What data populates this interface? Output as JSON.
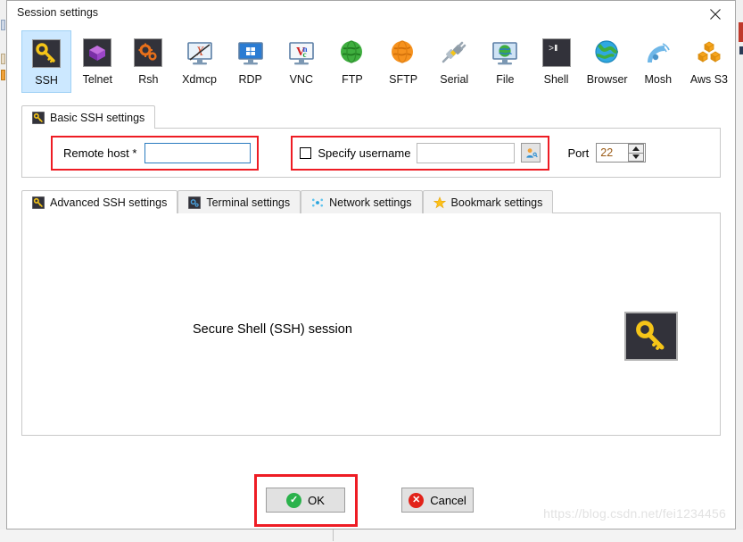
{
  "window": {
    "title": "Session settings",
    "close_icon": "close-icon"
  },
  "session_types": {
    "selected": "SSH",
    "items": [
      {
        "label": "SSH",
        "icon": "key-icon"
      },
      {
        "label": "Telnet",
        "icon": "cube-icon"
      },
      {
        "label": "Rsh",
        "icon": "gears-icon"
      },
      {
        "label": "Xdmcp",
        "icon": "x-monitor-icon"
      },
      {
        "label": "RDP",
        "icon": "windows-monitor-icon"
      },
      {
        "label": "VNC",
        "icon": "vnc-monitor-icon"
      },
      {
        "label": "FTP",
        "icon": "green-globe-icon"
      },
      {
        "label": "SFTP",
        "icon": "orange-globe-icon"
      },
      {
        "label": "Serial",
        "icon": "plug-icon"
      },
      {
        "label": "File",
        "icon": "file-monitor-icon"
      },
      {
        "label": "Shell",
        "icon": "terminal-icon"
      },
      {
        "label": "Browser",
        "icon": "browser-globe-icon"
      },
      {
        "label": "Mosh",
        "icon": "satellite-dish-icon"
      },
      {
        "label": "Aws S3",
        "icon": "aws-boxes-icon"
      }
    ]
  },
  "basic_tab": {
    "label": "Basic SSH settings",
    "icon": "key-icon",
    "remote_host": {
      "label": "Remote host *",
      "value": "",
      "placeholder": ""
    },
    "specify_username": {
      "label": "Specify username",
      "checked": false,
      "value": "",
      "placeholder": "",
      "picker_icon": "user-key-icon"
    },
    "port": {
      "label": "Port",
      "value": "22",
      "spinner_up_icon": "chevron-up-icon",
      "spinner_down_icon": "chevron-down-icon"
    }
  },
  "sub_tabs": {
    "active": "Advanced SSH settings",
    "items": [
      {
        "label": "Advanced SSH settings",
        "icon": "key-icon"
      },
      {
        "label": "Terminal settings",
        "icon": "terminal-gear-icon"
      },
      {
        "label": "Network settings",
        "icon": "network-nodes-icon"
      },
      {
        "label": "Bookmark settings",
        "icon": "star-icon"
      }
    ]
  },
  "session_panel": {
    "description": "Secure Shell (SSH) session",
    "large_icon": "key-icon"
  },
  "footer": {
    "ok_label": "OK",
    "ok_icon": "check-circle-icon",
    "cancel_label": "Cancel",
    "cancel_icon": "x-circle-icon"
  },
  "watermark": {
    "text": "https://blog.csdn.net/fei1234456"
  },
  "colors": {
    "highlight_red": "#ee1c24",
    "selected_tab_blue": "#cce8ff",
    "focus_border_blue": "#2b7cc0",
    "ok_green": "#2bb24c",
    "cancel_red": "#e2231a"
  }
}
